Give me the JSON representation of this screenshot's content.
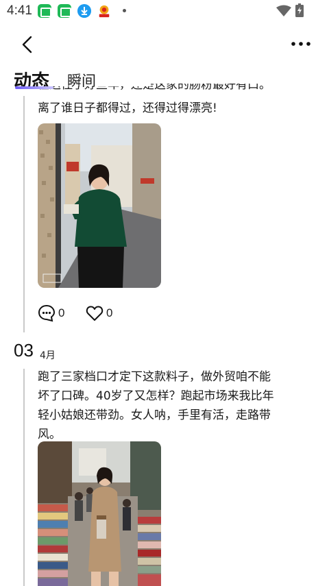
{
  "status_bar": {
    "time": "4:41",
    "icons": [
      "app-notification-icon",
      "app-notification-icon",
      "download-icon",
      "app-badge-icon",
      "more-dot-icon",
      "wifi-icon",
      "battery-charging-icon"
    ]
  },
  "header": {
    "back_icon": "chevron-left-icon",
    "more_icon": "more-horizontal-icon"
  },
  "tabs": [
    {
      "label": "动态",
      "active": true
    },
    {
      "label": "瞬间",
      "active": false
    }
  ],
  "posts": [
    {
      "partial_top_line": "在这住了好些年，还是这家的肠粉最好有口。",
      "text": "离了谁日子都得过，还得过得漂亮!",
      "image_description": "woman-in-green-blouse-street-photo",
      "comment_count": "0",
      "like_count": "0"
    },
    {
      "date_day": "03",
      "date_month": "4月",
      "text_lines": [
        "跑了三家档口才定下这款料子，做外贸咱不能",
        "坏了口碑。40岁了又怎样？跑起市场来我比年",
        "轻小姑娘还带劲。女人呐，手里有活，走路带",
        "风。"
      ],
      "image_description": "woman-in-trench-coat-fabric-market-photo"
    }
  ],
  "colors": {
    "accent": "#6d5cf5",
    "timeline": "#c9c9c9",
    "text": "#1a1a1a"
  }
}
